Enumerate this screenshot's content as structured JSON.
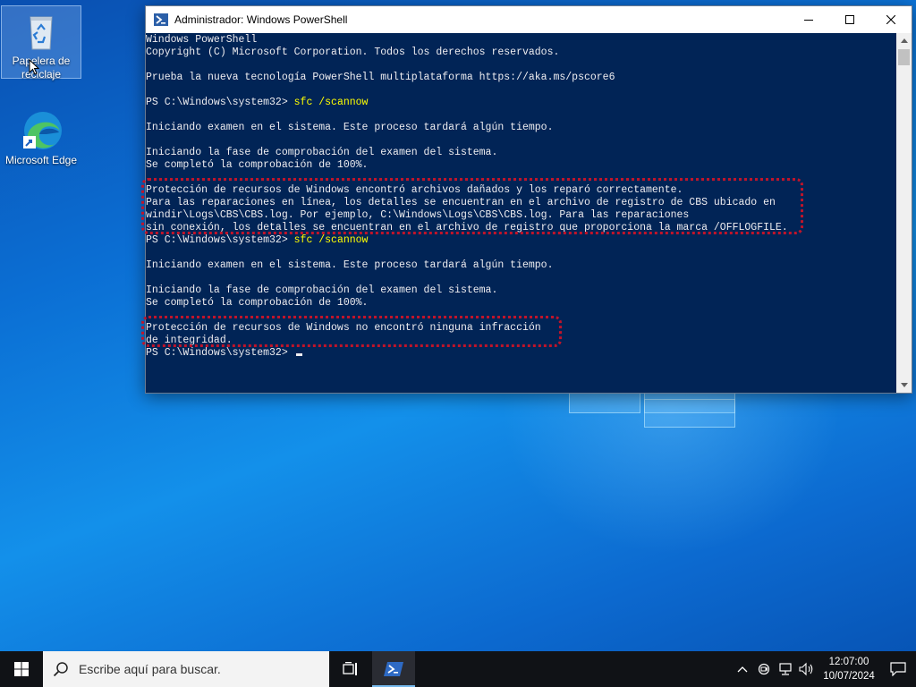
{
  "desktop": {
    "icons": [
      {
        "label": "Papelera de reciclaje"
      },
      {
        "label": "Microsoft Edge"
      }
    ]
  },
  "window": {
    "title": "Administrador: Windows PowerShell",
    "console_lines": [
      {
        "text": "Windows PowerShell"
      },
      {
        "text": "Copyright (C) Microsoft Corporation. Todos los derechos reservados."
      },
      {
        "text": ""
      },
      {
        "text": "Prueba la nueva tecnología PowerShell multiplataforma https://aka.ms/pscore6"
      },
      {
        "text": ""
      },
      {
        "prompt": "PS C:\\Windows\\system32> ",
        "command": "sfc /scannow"
      },
      {
        "text": ""
      },
      {
        "text": "Iniciando examen en el sistema. Este proceso tardará algún tiempo."
      },
      {
        "text": ""
      },
      {
        "text": "Iniciando la fase de comprobación del examen del sistema."
      },
      {
        "text": "Se completó la comprobación de 100%."
      },
      {
        "text": ""
      },
      {
        "text": "Protección de recursos de Windows encontró archivos dañados y los reparó correctamente."
      },
      {
        "text": "Para las reparaciones en línea, los detalles se encuentran en el archivo de registro de CBS ubicado en"
      },
      {
        "text": "windir\\Logs\\CBS\\CBS.log. Por ejemplo, C:\\Windows\\Logs\\CBS\\CBS.log. Para las reparaciones"
      },
      {
        "text": "sin conexión, los detalles se encuentran en el archivo de registro que proporciona la marca /OFFLOGFILE."
      },
      {
        "prompt": "PS C:\\Windows\\system32> ",
        "command": "sfc /scannow"
      },
      {
        "text": ""
      },
      {
        "text": "Iniciando examen en el sistema. Este proceso tardará algún tiempo."
      },
      {
        "text": ""
      },
      {
        "text": "Iniciando la fase de comprobación del examen del sistema."
      },
      {
        "text": "Se completó la comprobación de 100%."
      },
      {
        "text": ""
      },
      {
        "text": "Protección de recursos de Windows no encontró ninguna infracción"
      },
      {
        "text": "de integridad."
      },
      {
        "prompt": "PS C:\\Windows\\system32> ",
        "command": "",
        "cursor": true
      }
    ]
  },
  "taskbar": {
    "search_placeholder": "Escribe aquí para buscar.",
    "time": "12:07:00",
    "date": "10/07/2024"
  },
  "colors": {
    "console_bg": "#012456",
    "console_text": "#eeedf0",
    "command_text": "#ffff00",
    "highlight": "#c0142a"
  }
}
